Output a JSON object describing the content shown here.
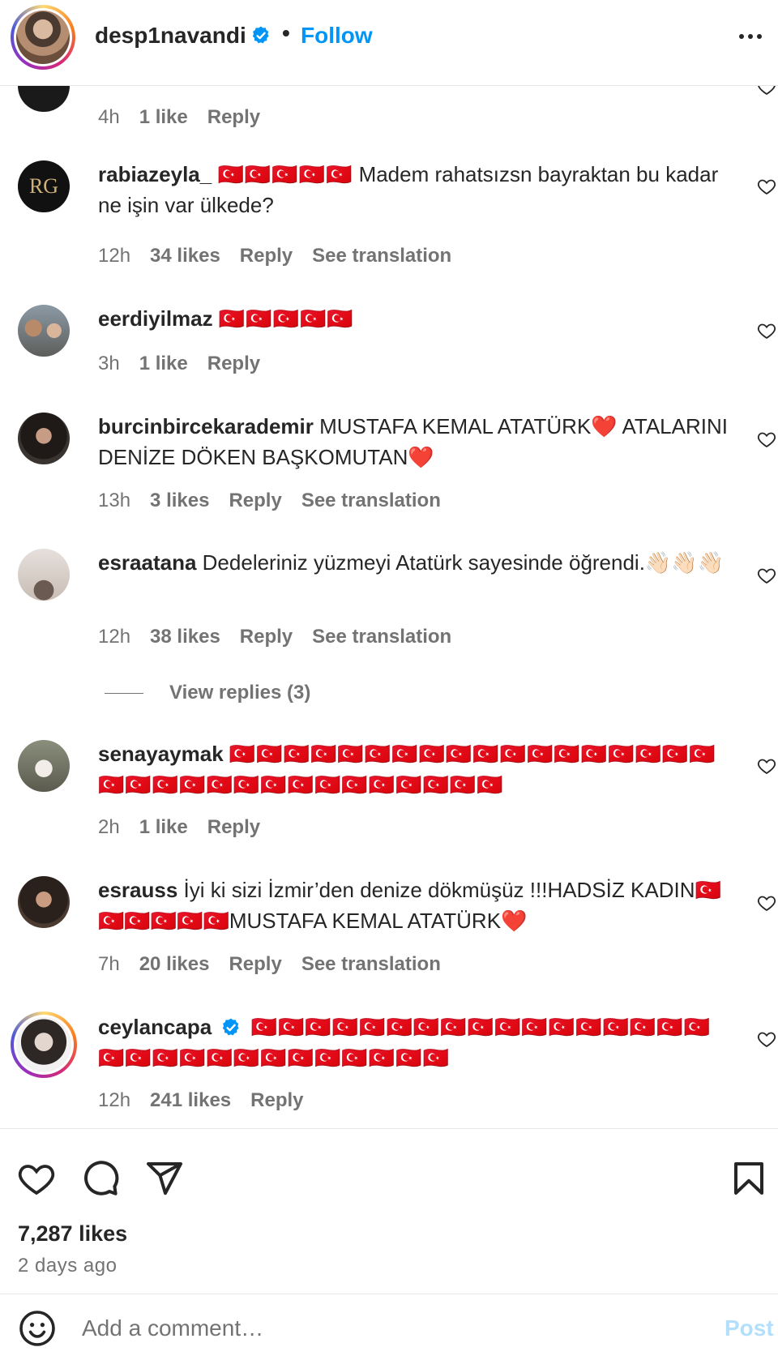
{
  "header": {
    "username": "desp1navandi",
    "separator": "•",
    "follow_label": "Follow"
  },
  "comments": [
    {
      "id": "partial",
      "username": "",
      "text": "",
      "time": "4h",
      "likes": "1 like",
      "reply": "Reply",
      "translation": ""
    },
    {
      "id": "rabiazeyla",
      "username": "rabiazeyla_",
      "flags": "🇹🇷🇹🇷🇹🇷🇹🇷🇹🇷",
      "text": "Madem rahatsızsn bayraktan bu kadar ne işin var ülkede?",
      "time": "12h",
      "likes": "34 likes",
      "reply": "Reply",
      "translation": "See translation"
    },
    {
      "id": "eerdiyilmaz",
      "username": "eerdiyilmaz",
      "flags": "🇹🇷🇹🇷🇹🇷🇹🇷🇹🇷",
      "text": "",
      "time": "3h",
      "likes": "1 like",
      "reply": "Reply",
      "translation": ""
    },
    {
      "id": "burcin",
      "username": "burcinbircekarademir",
      "text": "MUSTAFA KEMAL ATATÜRK❤️ ATALARINI DENİZE DÖKEN BAŞKOMUTAN❤️",
      "time": "13h",
      "likes": "3 likes",
      "reply": "Reply",
      "translation": "See translation"
    },
    {
      "id": "esraatana",
      "username": "esraatana",
      "text": "Dedeleriniz yüzmeyi Atatürk sayesinde öğrendi.👋🏻👋🏻👋🏻",
      "time": "12h",
      "likes": "38 likes",
      "reply": "Reply",
      "translation": "See translation",
      "view_replies": "View replies (3)"
    },
    {
      "id": "senayaymak",
      "username": "senayaymak",
      "flags": "🇹🇷🇹🇷🇹🇷🇹🇷🇹🇷🇹🇷🇹🇷🇹🇷🇹🇷🇹🇷🇹🇷🇹🇷🇹🇷🇹🇷🇹🇷🇹🇷🇹🇷🇹🇷🇹🇷🇹🇷🇹🇷🇹🇷🇹🇷🇹🇷🇹🇷🇹🇷🇹🇷🇹🇷🇹🇷🇹🇷🇹🇷🇹🇷🇹🇷",
      "text": "",
      "time": "2h",
      "likes": "1 like",
      "reply": "Reply",
      "translation": ""
    },
    {
      "id": "esrauss",
      "username": "esrauss",
      "text": "İyi ki sizi İzmir’den denize dökmüşüz !!!HADSİZ KADIN🇹🇷🇹🇷🇹🇷🇹🇷🇹🇷🇹🇷MUSTAFA KEMAL ATATÜRK❤️",
      "time": "7h",
      "likes": "20 likes",
      "reply": "Reply",
      "translation": "See translation"
    },
    {
      "id": "ceylancapa",
      "username": "ceylancapa",
      "flags": "🇹🇷🇹🇷🇹🇷🇹🇷🇹🇷🇹🇷🇹🇷🇹🇷🇹🇷🇹🇷🇹🇷🇹🇷🇹🇷🇹🇷🇹🇷🇹🇷🇹🇷🇹🇷🇹🇷🇹🇷🇹🇷🇹🇷🇹🇷🇹🇷🇹🇷🇹🇷🇹🇷🇹🇷🇹🇷🇹🇷",
      "text": "",
      "time": "12h",
      "likes": "241 likes",
      "reply": "Reply",
      "translation": ""
    }
  ],
  "post": {
    "likes": "7,287 likes",
    "date": "2 days ago"
  },
  "composer": {
    "placeholder": "Add a comment…",
    "post_label": "Post"
  },
  "colors": {
    "accent": "#0095f6",
    "post_disabled": "#b2dffc",
    "meta_gray": "#737373",
    "text": "#262626"
  },
  "icons": [
    "verified-badge-icon",
    "more-options-icon",
    "heart-icon",
    "comment-icon",
    "share-icon",
    "bookmark-icon",
    "emoji-icon"
  ]
}
